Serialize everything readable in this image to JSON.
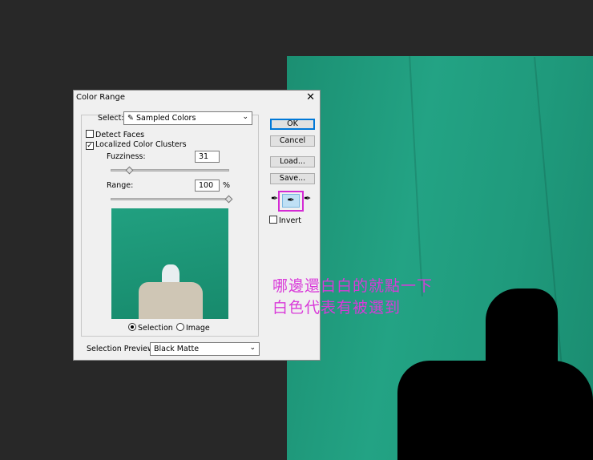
{
  "dialog": {
    "title": "Color Range",
    "close": "✕",
    "select_label": "Select:",
    "select_value": "Sampled Colors",
    "detect_faces": "Detect Faces",
    "localized": "Localized Color Clusters",
    "fuzziness_label": "Fuzziness:",
    "fuzziness": "31",
    "fuzziness_fraction": 0.16,
    "range_label": "Range:",
    "range": "100",
    "range_unit": "%",
    "range_fraction": 1.0,
    "selection": "Selection",
    "image": "Image",
    "preview_label": "Selection Preview:",
    "preview_value": "Black Matte",
    "ok": "OK",
    "cancel": "Cancel",
    "load": "Load...",
    "save": "Save...",
    "invert": "Invert"
  },
  "annotation": {
    "line1": "哪邊還白白的就點一下",
    "line2": "白色代表有被選到"
  },
  "colors": {
    "highlight": "#d42ad4",
    "green": "#1f9a7c"
  }
}
